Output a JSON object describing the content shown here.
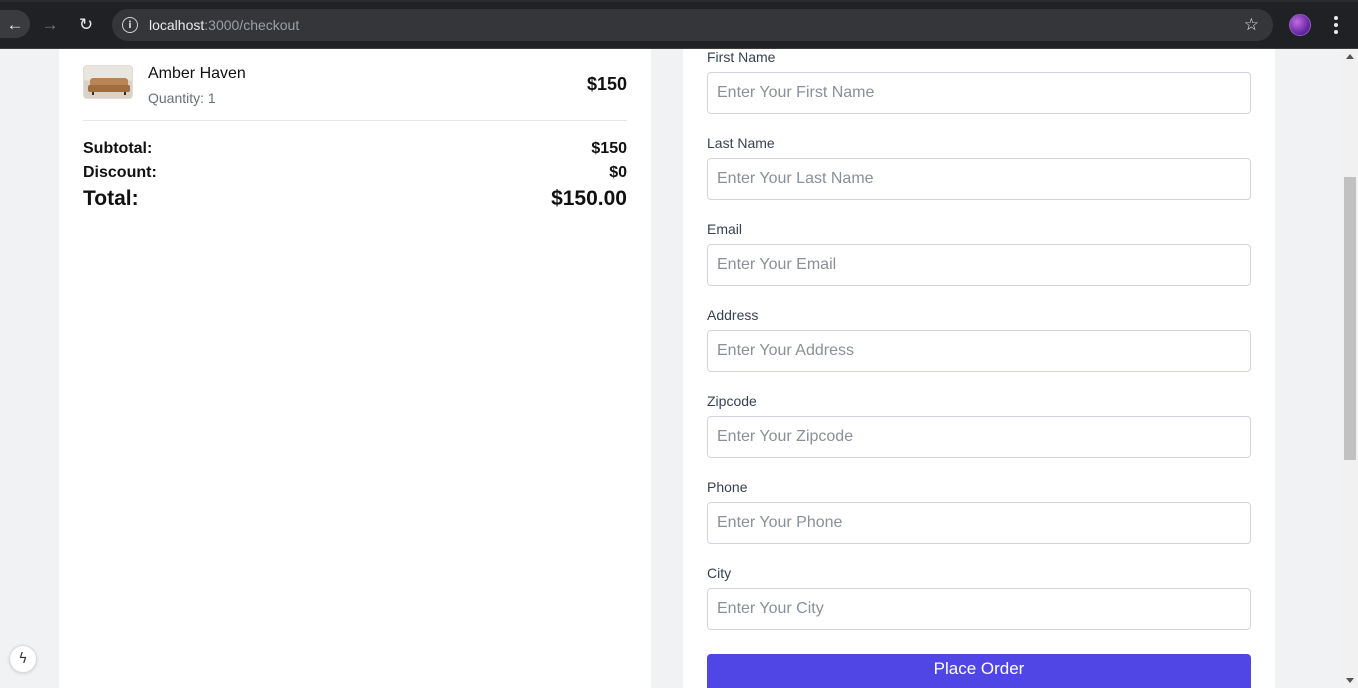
{
  "browser": {
    "url_host": "localhost",
    "url_path": ":3000/checkout",
    "back_glyph": "←",
    "forward_glyph": "→",
    "reload_glyph": "↻",
    "info_glyph": "i",
    "star_glyph": "☆",
    "icons": [
      "back-arrow-icon",
      "forward-arrow-icon",
      "reload-icon",
      "info-icon",
      "star-icon",
      "profile-avatar",
      "kebab-menu-icon"
    ]
  },
  "order_summary": {
    "item": {
      "name": "Amber Haven",
      "quantity_text": "Quantity: 1",
      "price": "$150",
      "thumbnail_icon": "sofa-thumbnail"
    },
    "subtotal_label": "Subtotal:",
    "subtotal_value": "$150",
    "discount_label": "Discount:",
    "discount_value": "$0",
    "total_label": "Total:",
    "total_value": "$150.00"
  },
  "form": {
    "fields": [
      {
        "label": "First Name",
        "placeholder": "Enter Your First Name",
        "value": ""
      },
      {
        "label": "Last Name",
        "placeholder": "Enter Your Last Name",
        "value": ""
      },
      {
        "label": "Email",
        "placeholder": "Enter Your Email",
        "value": ""
      },
      {
        "label": "Address",
        "placeholder": "Enter Your Address",
        "value": ""
      },
      {
        "label": "Zipcode",
        "placeholder": "Enter Your Zipcode",
        "value": ""
      },
      {
        "label": "Phone",
        "placeholder": "Enter Your Phone",
        "value": ""
      },
      {
        "label": "City",
        "placeholder": "Enter Your City",
        "value": ""
      }
    ],
    "submit_label": "Place Order"
  },
  "dev_indicator_glyph": "ϟ",
  "colors": {
    "accent": "#4f46e5",
    "page_bg": "#f1f2f4",
    "chrome_bg": "#202124"
  }
}
